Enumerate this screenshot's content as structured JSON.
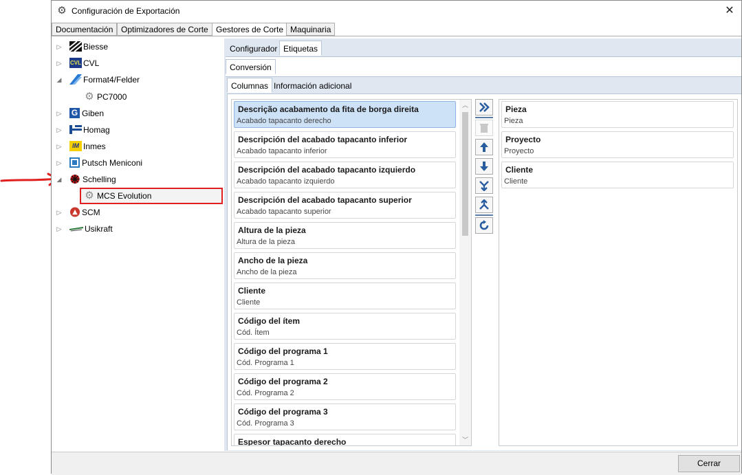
{
  "window": {
    "title": "Configuración de Exportación",
    "close_glyph": "✕"
  },
  "top_tabs": [
    {
      "label": "Documentación"
    },
    {
      "label": "Optimizadores de Corte"
    },
    {
      "label": "Gestores de Corte"
    },
    {
      "label": "Maquinaria"
    }
  ],
  "active_top_tab": "Gestores de Corte",
  "tree": {
    "items": [
      {
        "label": "Biesse",
        "icon": "biesse-logo-icon",
        "expanded": false
      },
      {
        "label": "CVL",
        "icon": "cvl-logo-icon",
        "icon_text": "CVL",
        "expanded": false
      },
      {
        "label": "Format4/Felder",
        "icon": "format4-logo-icon",
        "expanded": true
      },
      {
        "label": "PC7000",
        "icon": "gear-icon",
        "child": true
      },
      {
        "label": "Giben",
        "icon": "giben-logo-icon",
        "icon_text": "G",
        "expanded": false
      },
      {
        "label": "Homag",
        "icon": "homag-logo-icon",
        "expanded": false
      },
      {
        "label": "Inmes",
        "icon": "inmes-logo-icon",
        "icon_text": "IM",
        "expanded": false
      },
      {
        "label": "Putsch Meniconi",
        "icon": "putsch-logo-icon",
        "expanded": false
      },
      {
        "label": "Schelling",
        "icon": "schelling-logo-icon",
        "expanded": true
      },
      {
        "label": "MCS Evolution",
        "icon": "gear-icon",
        "child": true,
        "selected": true
      },
      {
        "label": "SCM",
        "icon": "scm-logo-icon",
        "expanded": false
      },
      {
        "label": "Usikraft",
        "icon": "usikraft-logo-icon",
        "expanded": false
      }
    ]
  },
  "sub_tabs": {
    "level1": [
      "Configurador",
      "Etiquetas"
    ],
    "level1_active": "Etiquetas",
    "level2": [
      "Conversión"
    ],
    "level3": [
      "Columnas",
      "Información adicional"
    ],
    "level3_active": "Columnas"
  },
  "available_columns": [
    {
      "title": "Descrição acabamento da fita de borga direita",
      "subtitle": "Acabado tapacanto derecho",
      "selected": true
    },
    {
      "title": "Descripción del acabado tapacanto inferior",
      "subtitle": "Acabado tapacanto inferior"
    },
    {
      "title": "Descripción del acabado tapacanto izquierdo",
      "subtitle": "Acabado tapacanto izquierdo"
    },
    {
      "title": "Descripción del acabado tapacanto superior",
      "subtitle": "Acabado tapacanto superior"
    },
    {
      "title": "Altura de la pieza",
      "subtitle": "Altura de la pieza"
    },
    {
      "title": "Ancho de la pieza",
      "subtitle": "Ancho de la pieza"
    },
    {
      "title": "Cliente",
      "subtitle": "Cliente"
    },
    {
      "title": "Código del ítem",
      "subtitle": "Cód. Ítem"
    },
    {
      "title": "Código del programa 1",
      "subtitle": "Cód. Programa 1"
    },
    {
      "title": "Código del programa 2",
      "subtitle": "Cód. Programa 2"
    },
    {
      "title": "Código del programa 3",
      "subtitle": "Cód. Programa 3"
    },
    {
      "title": "Espesor tapacanto derecho",
      "subtitle": ""
    }
  ],
  "selected_columns": [
    {
      "title": "Pieza",
      "subtitle": "Pieza"
    },
    {
      "title": "Proyecto",
      "subtitle": "Proyecto"
    },
    {
      "title": "Cliente",
      "subtitle": "Cliente"
    }
  ],
  "toolbar_buttons": [
    "add-all-icon",
    "delete-icon",
    "move-up-icon",
    "move-down-icon",
    "merge-down-icon",
    "split-icon",
    "refresh-icon"
  ],
  "footer": {
    "close_label": "Cerrar"
  },
  "colors": {
    "accent_blue": "#2a5d9f",
    "selection": "#cde1f7",
    "annotation_red": "#e02020",
    "panel_bg": "#dfe7f1"
  }
}
